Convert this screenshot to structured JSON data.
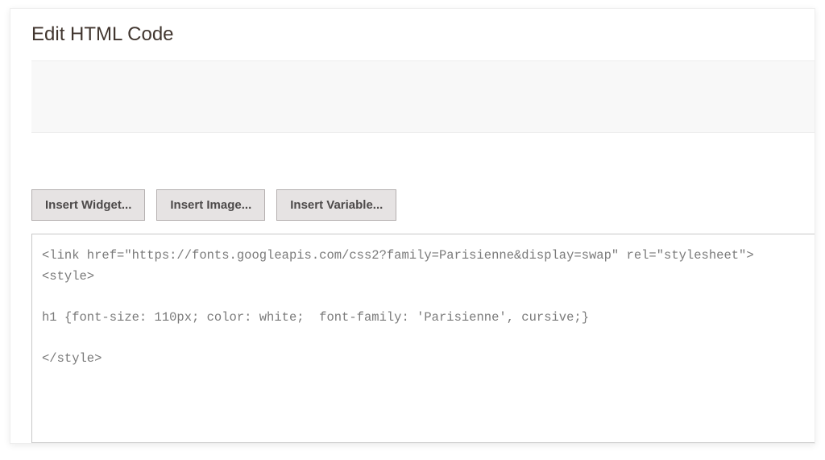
{
  "header": {
    "title": "Edit HTML Code"
  },
  "toolbar": {
    "insert_widget_label": "Insert Widget...",
    "insert_image_label": "Insert Image...",
    "insert_variable_label": "Insert Variable..."
  },
  "editor": {
    "content": "<link href=\"https://fonts.googleapis.com/css2?family=Parisienne&display=swap\" rel=\"stylesheet\">\n<style>\n\nh1 {font-size: 110px; color: white;  font-family: 'Parisienne', cursive;}\n\n</style>"
  }
}
